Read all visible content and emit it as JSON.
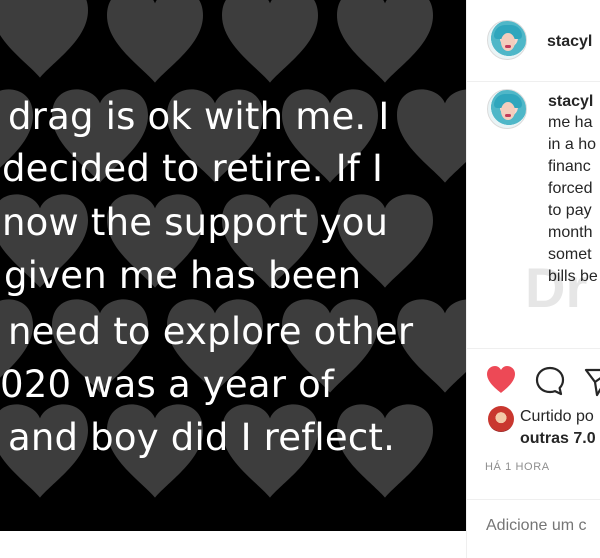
{
  "media": {
    "caption_lines": [
      "drag is ok with me. I",
      "decided to retire. If I",
      "now the support you",
      "given me has been",
      "need to explore other",
      "020 was a year of",
      "and boy did I reflect."
    ]
  },
  "post": {
    "username": "stacyl",
    "comment_username": "stacyl",
    "comment_lines": [
      "me ha",
      "in a ho",
      "financ",
      "forced",
      "to pay",
      "month",
      "somet",
      "bills be"
    ],
    "watermark": "Dr"
  },
  "actions": {
    "like_icon": "heart-filled-icon",
    "comment_icon": "comment-icon",
    "share_icon": "share-icon",
    "like_color": "#ed4956"
  },
  "likes": {
    "liked_by": "Curtido po",
    "others": "outras 7.0"
  },
  "timestamp": "HÁ 1 HORA",
  "add_comment": {
    "placeholder": "Adicione um c"
  }
}
